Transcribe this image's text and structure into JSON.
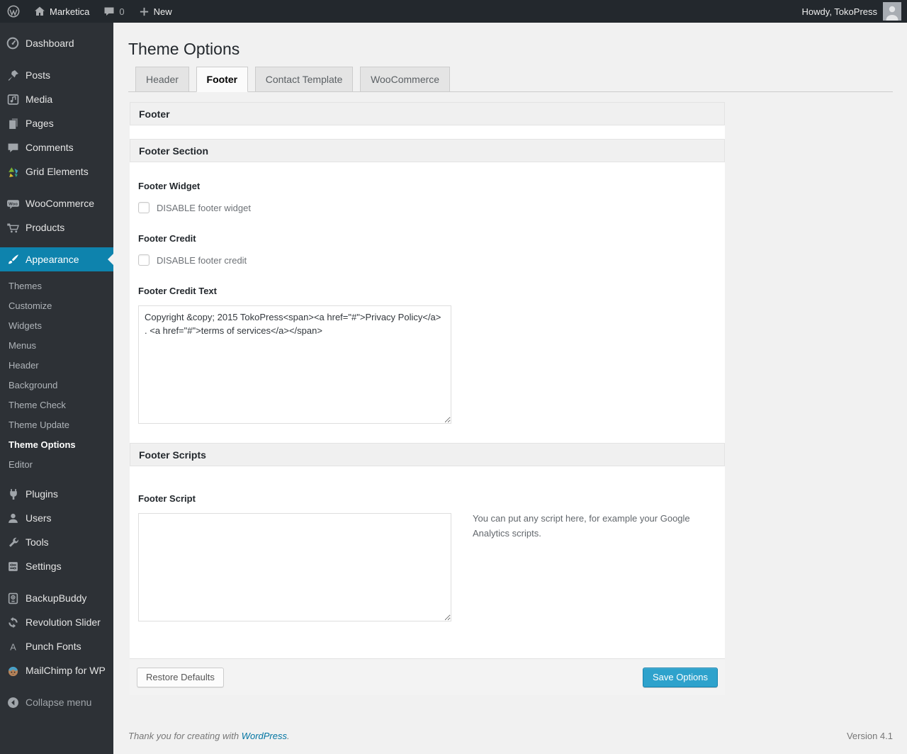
{
  "adminbar": {
    "site_name": "Marketica",
    "comment_count": "0",
    "new_label": "New",
    "howdy": "Howdy, TokoPress"
  },
  "sidebar": {
    "items": [
      {
        "label": "Dashboard"
      },
      {
        "label": "Posts"
      },
      {
        "label": "Media"
      },
      {
        "label": "Pages"
      },
      {
        "label": "Comments"
      },
      {
        "label": "Grid Elements"
      },
      {
        "label": "WooCommerce"
      },
      {
        "label": "Products"
      },
      {
        "label": "Appearance"
      },
      {
        "label": "Plugins"
      },
      {
        "label": "Users"
      },
      {
        "label": "Tools"
      },
      {
        "label": "Settings"
      },
      {
        "label": "BackupBuddy"
      },
      {
        "label": "Revolution Slider"
      },
      {
        "label": "Punch Fonts"
      },
      {
        "label": "MailChimp for WP"
      },
      {
        "label": "Collapse menu"
      }
    ],
    "submenu": [
      {
        "label": "Themes"
      },
      {
        "label": "Customize"
      },
      {
        "label": "Widgets"
      },
      {
        "label": "Menus"
      },
      {
        "label": "Header"
      },
      {
        "label": "Background"
      },
      {
        "label": "Theme Check"
      },
      {
        "label": "Theme Update"
      },
      {
        "label": "Theme Options"
      },
      {
        "label": "Editor"
      }
    ]
  },
  "main": {
    "title": "Theme Options",
    "tabs": [
      {
        "label": "Header"
      },
      {
        "label": "Footer"
      },
      {
        "label": "Contact Template"
      },
      {
        "label": "WooCommerce"
      }
    ]
  },
  "panel": {
    "title": "Footer",
    "section1": {
      "title": "Footer Section",
      "widget_label": "Footer Widget",
      "widget_checkbox_label": "DISABLE footer widget",
      "credit_label": "Footer Credit",
      "credit_checkbox_label": "DISABLE footer credit",
      "credit_text_label": "Footer Credit Text",
      "credit_text_value": "Copyright &copy; 2015 TokoPress<span><a href=\"#\">Privacy Policy</a> . <a href=\"#\">terms of services</a></span>"
    },
    "section2": {
      "title": "Footer Scripts",
      "script_label": "Footer Script",
      "script_value": "",
      "script_help": "You can put any script here, for example your Google Analytics scripts."
    },
    "restore_label": "Restore Defaults",
    "save_label": "Save Options"
  },
  "footer": {
    "thanks_prefix": "Thank you for creating with ",
    "thanks_link": "WordPress",
    "thanks_suffix": ".",
    "version": "Version 4.1"
  },
  "colors": {
    "accent": "#0e83ad",
    "primary_button": "#2ea2cc",
    "adminbar_bg": "#23282d",
    "sidebar_bg": "#2d3136"
  }
}
